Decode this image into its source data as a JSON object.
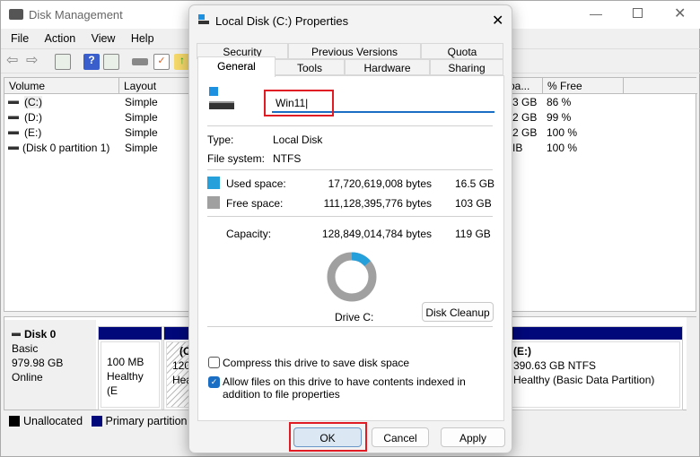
{
  "main": {
    "title": "Disk Management",
    "menu": [
      "File",
      "Action",
      "View",
      "Help"
    ],
    "columns": [
      "Volume",
      "Layout",
      "pa...",
      "% Free"
    ],
    "rows": [
      {
        "volume": "(C:)",
        "layout": "Simple",
        "free_space": "3 GB",
        "pct_free": "86 %"
      },
      {
        "volume": "(D:)",
        "layout": "Simple",
        "free_space": "2 GB",
        "pct_free": "99 %"
      },
      {
        "volume": "(E:)",
        "layout": "Simple",
        "free_space": "2 GB",
        "pct_free": "100 %"
      },
      {
        "volume": "(Disk 0 partition 1)",
        "layout": "Simple",
        "free_space": "IB",
        "pct_free": "100 %"
      }
    ],
    "disk": {
      "name": "Disk 0",
      "type": "Basic",
      "size": "979.98 GB",
      "status": "Online"
    },
    "partitions": [
      {
        "line1": "100 MB",
        "line2": "Healthy (E"
      },
      {
        "name": "(C:)",
        "line1": "120.0",
        "line2": "Heal"
      },
      {
        "name": "(E:)",
        "line1": "390.63 GB NTFS",
        "line2": "Healthy (Basic Data Partition)"
      }
    ],
    "legend": [
      {
        "label": "Unallocated",
        "color": "#000000"
      },
      {
        "label": "Primary partition",
        "color": "#00087a"
      }
    ]
  },
  "dialog": {
    "title": "Local Disk (C:) Properties",
    "tabs_row1": [
      "Security",
      "Previous Versions",
      "Quota"
    ],
    "tabs_row2": [
      "General",
      "Tools",
      "Hardware",
      "Sharing"
    ],
    "active_tab": "General",
    "label_value": "Win11",
    "type_label": "Type:",
    "type_value": "Local Disk",
    "fs_label": "File system:",
    "fs_value": "NTFS",
    "used_label": "Used space:",
    "used_bytes": "17,720,619,008 bytes",
    "used_gb": "16.5 GB",
    "used_color": "#26a0da",
    "free_label": "Free space:",
    "free_bytes": "111,128,395,776 bytes",
    "free_gb": "103 GB",
    "free_color": "#a0a0a0",
    "cap_label": "Capacity:",
    "cap_bytes": "128,849,014,784 bytes",
    "cap_gb": "119 GB",
    "used_fraction": 0.1375,
    "drive_label": "Drive C:",
    "cleanup": "Disk Cleanup",
    "compress": {
      "label": "Compress this drive to save disk space",
      "checked": false
    },
    "index": {
      "label": "Allow files on this drive to have contents indexed in addition to file properties",
      "checked": true
    },
    "ok": "OK",
    "cancel": "Cancel",
    "apply": "Apply"
  }
}
